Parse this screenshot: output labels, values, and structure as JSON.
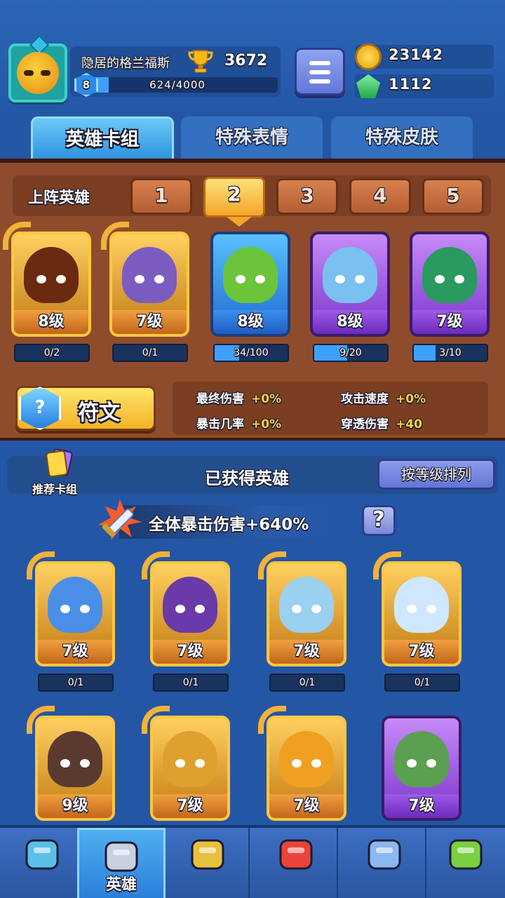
{
  "player": {
    "name": "隐居的格兰福斯",
    "trophies": "3672",
    "level": "8",
    "xp": "624/4000",
    "xp_fraction": 0.156
  },
  "currency": {
    "gold": "23142",
    "gems": "1112"
  },
  "tabs": [
    {
      "label": "英雄卡组"
    },
    {
      "label": "特殊表情"
    },
    {
      "label": "特殊皮肤"
    }
  ],
  "deck": {
    "label": "上阵英雄",
    "slots": [
      "1",
      "2",
      "3",
      "4",
      "5"
    ],
    "active_slot": 2,
    "cards": [
      {
        "level": "8级",
        "progress": "0/2",
        "fill": 0,
        "rarity": "gold",
        "color": "#6a2a10"
      },
      {
        "level": "7级",
        "progress": "0/1",
        "fill": 0,
        "rarity": "gold",
        "color": "#7b5cc0"
      },
      {
        "level": "8级",
        "progress": "34/100",
        "fill": 0.34,
        "rarity": "blue",
        "color": "#6cc43a"
      },
      {
        "level": "8级",
        "progress": "9/20",
        "fill": 0.45,
        "rarity": "purple",
        "color": "#7ac0f0"
      },
      {
        "level": "7级",
        "progress": "3/10",
        "fill": 0.3,
        "rarity": "purple",
        "color": "#2a9a60"
      }
    ]
  },
  "rune": {
    "label": "符文",
    "icon": "?"
  },
  "stats": [
    {
      "name": "最终伤害",
      "value": "+0%"
    },
    {
      "name": "攻击速度",
      "value": "+0%"
    },
    {
      "name": "暴击几率",
      "value": "+0%"
    },
    {
      "name": "穿透伤害",
      "value": "+40"
    }
  ],
  "owned": {
    "recommend_label": "推荐卡组",
    "title": "已获得英雄",
    "sort_label": "按等级排列"
  },
  "crit_bonus": {
    "text": "全体暴击伤害+640%",
    "help": "?"
  },
  "owned_cards": [
    {
      "level": "7级",
      "progress": "0/1",
      "rarity": "gold",
      "color": "#4a8ee8"
    },
    {
      "level": "7级",
      "progress": "0/1",
      "rarity": "gold",
      "color": "#6a3aa8"
    },
    {
      "level": "7级",
      "progress": "0/1",
      "rarity": "gold",
      "color": "#9ad0f0"
    },
    {
      "level": "7级",
      "progress": "0/1",
      "rarity": "gold",
      "color": "#cfe8ff"
    },
    {
      "level": "9级",
      "progress": "",
      "rarity": "gold",
      "color": "#5a3a30"
    },
    {
      "level": "7级",
      "progress": "",
      "rarity": "gold",
      "color": "#e0a030"
    },
    {
      "level": "7级",
      "progress": "",
      "rarity": "gold",
      "color": "#f0a020"
    },
    {
      "level": "7级",
      "progress": "",
      "rarity": "purple",
      "color": "#5aa050"
    }
  ],
  "nav": {
    "active_label": "英雄",
    "items": [
      "chest-icon",
      "helmet-icon",
      "swords-icon",
      "shield-crown-icon",
      "guild-banner-icon",
      "sprout-icon"
    ]
  }
}
